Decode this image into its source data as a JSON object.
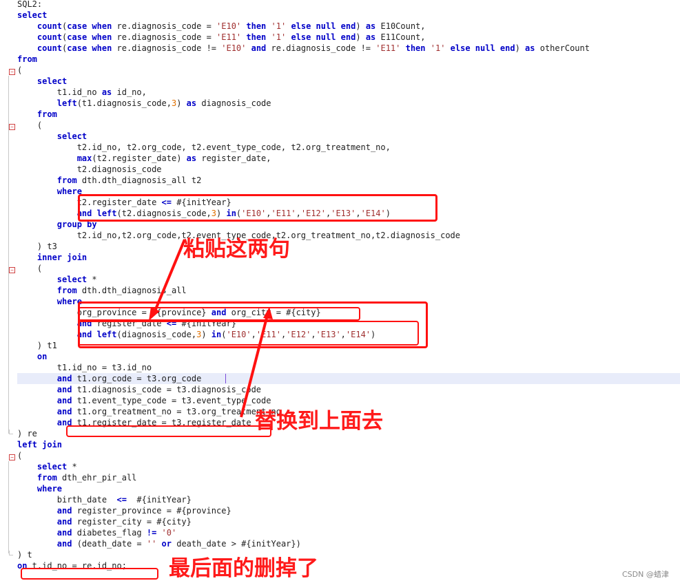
{
  "editor": {
    "lines": [
      [
        [
          "t",
          "SQL2:"
        ]
      ],
      [
        [
          "k",
          "select"
        ]
      ],
      [
        [
          "t",
          "    "
        ],
        [
          "k",
          "count"
        ],
        [
          "t",
          "("
        ],
        [
          "k",
          "case when"
        ],
        [
          "t",
          " re.diagnosis_code = "
        ],
        [
          "s",
          "'E10'"
        ],
        [
          "t",
          " "
        ],
        [
          "k",
          "then"
        ],
        [
          "t",
          " "
        ],
        [
          "s",
          "'1'"
        ],
        [
          "t",
          " "
        ],
        [
          "k",
          "else null end"
        ],
        [
          "t",
          ") "
        ],
        [
          "k",
          "as"
        ],
        [
          "t",
          " E10Count,"
        ]
      ],
      [
        [
          "t",
          "    "
        ],
        [
          "k",
          "count"
        ],
        [
          "t",
          "("
        ],
        [
          "k",
          "case when"
        ],
        [
          "t",
          " re.diagnosis_code = "
        ],
        [
          "s",
          "'E11'"
        ],
        [
          "t",
          " "
        ],
        [
          "k",
          "then"
        ],
        [
          "t",
          " "
        ],
        [
          "s",
          "'1'"
        ],
        [
          "t",
          " "
        ],
        [
          "k",
          "else null end"
        ],
        [
          "t",
          ") "
        ],
        [
          "k",
          "as"
        ],
        [
          "t",
          " E11Count,"
        ]
      ],
      [
        [
          "t",
          "    "
        ],
        [
          "k",
          "count"
        ],
        [
          "t",
          "("
        ],
        [
          "k",
          "case when"
        ],
        [
          "t",
          " re.diagnosis_code != "
        ],
        [
          "s",
          "'E10'"
        ],
        [
          "t",
          " "
        ],
        [
          "k",
          "and"
        ],
        [
          "t",
          " re.diagnosis_code != "
        ],
        [
          "s",
          "'E11'"
        ],
        [
          "t",
          " "
        ],
        [
          "k",
          "then"
        ],
        [
          "t",
          " "
        ],
        [
          "s",
          "'1'"
        ],
        [
          "t",
          " "
        ],
        [
          "k",
          "else null end"
        ],
        [
          "t",
          ") "
        ],
        [
          "k",
          "as"
        ],
        [
          "t",
          " otherCount"
        ]
      ],
      [
        [
          "k",
          "from"
        ]
      ],
      [
        [
          "t",
          "("
        ]
      ],
      [
        [
          "t",
          "    "
        ],
        [
          "k",
          "select"
        ]
      ],
      [
        [
          "t",
          "        t1.id_no "
        ],
        [
          "k",
          "as"
        ],
        [
          "t",
          " id_no,"
        ]
      ],
      [
        [
          "t",
          "        "
        ],
        [
          "k",
          "left"
        ],
        [
          "t",
          "(t1.diagnosis_code,"
        ],
        [
          "n",
          "3"
        ],
        [
          "t",
          ") "
        ],
        [
          "k",
          "as"
        ],
        [
          "t",
          " diagnosis_code"
        ]
      ],
      [
        [
          "t",
          "    "
        ],
        [
          "k",
          "from"
        ]
      ],
      [
        [
          "t",
          "    ("
        ]
      ],
      [
        [
          "t",
          "        "
        ],
        [
          "k",
          "select"
        ]
      ],
      [
        [
          "t",
          "            t2.id_no, t2.org_code, t2.event_type_code, t2.org_treatment_no,"
        ]
      ],
      [
        [
          "t",
          "            "
        ],
        [
          "k",
          "max"
        ],
        [
          "t",
          "(t2.register_date) "
        ],
        [
          "k",
          "as"
        ],
        [
          "t",
          " register_date,"
        ]
      ],
      [
        [
          "t",
          "            t2.diagnosis_code"
        ]
      ],
      [
        [
          "t",
          "        "
        ],
        [
          "k",
          "from"
        ],
        [
          "t",
          " dth.dth_diagnosis_all t2"
        ]
      ],
      [
        [
          "t",
          "        "
        ],
        [
          "k",
          "where"
        ]
      ],
      [
        [
          "t",
          "            t2.register_date "
        ],
        [
          "k",
          "<="
        ],
        [
          "t",
          " #{initYear}"
        ]
      ],
      [
        [
          "t",
          "            "
        ],
        [
          "k",
          "and left"
        ],
        [
          "t",
          "(t2.diagnosis_code,"
        ],
        [
          "n",
          "3"
        ],
        [
          "t",
          ") "
        ],
        [
          "k",
          "in"
        ],
        [
          "t",
          "("
        ],
        [
          "s",
          "'E10'"
        ],
        [
          "t",
          ","
        ],
        [
          "s",
          "'E11'"
        ],
        [
          "t",
          ","
        ],
        [
          "s",
          "'E12'"
        ],
        [
          "t",
          ","
        ],
        [
          "s",
          "'E13'"
        ],
        [
          "t",
          ","
        ],
        [
          "s",
          "'E14'"
        ],
        [
          "t",
          ")"
        ]
      ],
      [
        [
          "t",
          "        "
        ],
        [
          "k",
          "group by"
        ]
      ],
      [
        [
          "t",
          "            t2.id_no,t2.org_code,t2.event_type_code,t2.org_treatment_no,t2.diagnosis_code"
        ]
      ],
      [
        [
          "t",
          "    ) t3"
        ]
      ],
      [
        [
          "t",
          "    "
        ],
        [
          "k",
          "inner join"
        ]
      ],
      [
        [
          "t",
          "    ("
        ]
      ],
      [
        [
          "t",
          "        "
        ],
        [
          "k",
          "select"
        ],
        [
          "t",
          " *"
        ]
      ],
      [
        [
          "t",
          "        "
        ],
        [
          "k",
          "from"
        ],
        [
          "t",
          " dth.dth_diagnosis_all"
        ]
      ],
      [
        [
          "t",
          "        "
        ],
        [
          "k",
          "where"
        ]
      ],
      [
        [
          "t",
          "            org_province = #{province} "
        ],
        [
          "k",
          "and"
        ],
        [
          "t",
          " org_city = #{city}"
        ]
      ],
      [
        [
          "t",
          "            "
        ],
        [
          "k",
          "and"
        ],
        [
          "t",
          " register_date "
        ],
        [
          "k",
          "<="
        ],
        [
          "t",
          " #{initYear}"
        ]
      ],
      [
        [
          "t",
          "            "
        ],
        [
          "k",
          "and left"
        ],
        [
          "t",
          "(diagnosis_code,"
        ],
        [
          "n",
          "3"
        ],
        [
          "t",
          ") "
        ],
        [
          "k",
          "in"
        ],
        [
          "t",
          "("
        ],
        [
          "s",
          "'E10'"
        ],
        [
          "t",
          ","
        ],
        [
          "s",
          "'E11'"
        ],
        [
          "t",
          ","
        ],
        [
          "s",
          "'E12'"
        ],
        [
          "t",
          ","
        ],
        [
          "s",
          "'E13'"
        ],
        [
          "t",
          ","
        ],
        [
          "s",
          "'E14'"
        ],
        [
          "t",
          ")"
        ]
      ],
      [
        [
          "t",
          "    ) t1"
        ]
      ],
      [
        [
          "t",
          "    "
        ],
        [
          "k",
          "on"
        ]
      ],
      [
        [
          "t",
          "        t1.id_no = t3.id_no"
        ]
      ],
      [
        [
          "t",
          "        "
        ],
        [
          "k",
          "and"
        ],
        [
          "t",
          " t1.org_code = t3.org_code"
        ]
      ],
      [
        [
          "t",
          "        "
        ],
        [
          "k",
          "and"
        ],
        [
          "t",
          " t1.diagnosis_code = t3.diagnosis_code"
        ]
      ],
      [
        [
          "t",
          "        "
        ],
        [
          "k",
          "and"
        ],
        [
          "t",
          " t1.event_type_code = t3.event_type_code"
        ]
      ],
      [
        [
          "t",
          "        "
        ],
        [
          "k",
          "and"
        ],
        [
          "t",
          " t1.org_treatment_no = t3.org_treatment_no"
        ]
      ],
      [
        [
          "t",
          "        "
        ],
        [
          "k",
          "and"
        ],
        [
          "t",
          " t1.register_date = t3.register_date"
        ]
      ],
      [
        [
          "t",
          ") re"
        ]
      ],
      [
        [
          "k",
          "left join"
        ]
      ],
      [
        [
          "t",
          "("
        ]
      ],
      [
        [
          "t",
          "    "
        ],
        [
          "k",
          "select"
        ],
        [
          "t",
          " *"
        ]
      ],
      [
        [
          "t",
          "    "
        ],
        [
          "k",
          "from"
        ],
        [
          "t",
          " dth_ehr_pir_all"
        ]
      ],
      [
        [
          "t",
          "    "
        ],
        [
          "k",
          "where"
        ]
      ],
      [
        [
          "t",
          "        birth_date  "
        ],
        [
          "k",
          "<="
        ],
        [
          "t",
          "  #{initYear}"
        ]
      ],
      [
        [
          "t",
          "        "
        ],
        [
          "k",
          "and"
        ],
        [
          "t",
          " register_province = #{province}"
        ]
      ],
      [
        [
          "t",
          "        "
        ],
        [
          "k",
          "and"
        ],
        [
          "t",
          " register_city = #{city}"
        ]
      ],
      [
        [
          "t",
          "        "
        ],
        [
          "k",
          "and"
        ],
        [
          "t",
          " diabetes_flag "
        ],
        [
          "k",
          "!="
        ],
        [
          "t",
          " "
        ],
        [
          "s",
          "'0'"
        ]
      ],
      [
        [
          "t",
          "        "
        ],
        [
          "k",
          "and"
        ],
        [
          "t",
          " (death_date = "
        ],
        [
          "s",
          "''"
        ],
        [
          "t",
          " "
        ],
        [
          "k",
          "or"
        ],
        [
          "t",
          " death_date > #{initYear})"
        ]
      ],
      [
        [
          "t",
          ") t"
        ]
      ],
      [
        [
          "k",
          "on"
        ],
        [
          "t",
          " t.id_no = re.id_no;"
        ]
      ]
    ]
  },
  "annotations": {
    "paste": "粘贴这两句",
    "replace": "替换到上面去",
    "delete": "最后面的删掉了"
  },
  "watermark": "CSDN @蜡津",
  "colors": {
    "keyword": "#0000c8",
    "string": "#a03030",
    "number": "#e07000",
    "annotation": "#ff1010"
  }
}
